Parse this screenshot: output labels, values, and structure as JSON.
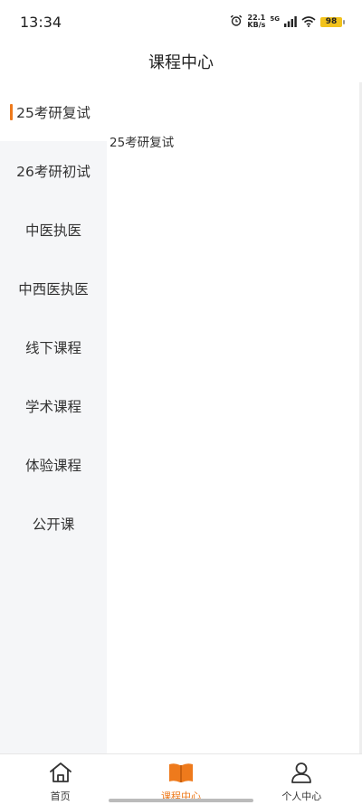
{
  "status": {
    "time": "13:34",
    "speed_value": "22.1",
    "speed_unit": "KB/s",
    "network": "5G",
    "battery": "98",
    "icons": [
      "alarm-icon",
      "signal-icon",
      "wifi-icon",
      "battery-icon"
    ]
  },
  "header": {
    "title": "课程中心"
  },
  "sidebar": {
    "items": [
      {
        "label": "25考研复试"
      },
      {
        "label": "26考研初试"
      },
      {
        "label": "中医执医"
      },
      {
        "label": "中西医执医"
      },
      {
        "label": "线下课程"
      },
      {
        "label": "学术课程"
      },
      {
        "label": "体验课程"
      },
      {
        "label": "公开课"
      }
    ],
    "active_index": 0
  },
  "main": {
    "section_title": "25考研复试"
  },
  "tabbar": {
    "tabs": [
      {
        "label": "首页",
        "icon": "home-icon"
      },
      {
        "label": "课程中心",
        "icon": "book-icon"
      },
      {
        "label": "个人中心",
        "icon": "user-icon"
      }
    ],
    "active_index": 1
  },
  "colors": {
    "accent": "#ee7a1c",
    "sidebar_bg": "#f5f6f8",
    "battery": "#f2c21b"
  }
}
